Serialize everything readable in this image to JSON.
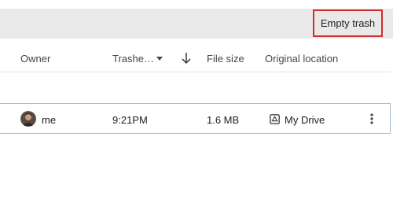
{
  "toolbar": {
    "empty_trash_label": "Empty trash"
  },
  "columns": {
    "owner": "Owner",
    "trashed": "Trashe…",
    "file_size": "File size",
    "original_location": "Original location"
  },
  "rows": [
    {
      "owner": "me",
      "trashed": "9:21PM",
      "file_size": "1.6 MB",
      "location": "My Drive"
    }
  ],
  "icons": {
    "sort": "chevron-down-icon",
    "sort_direction": "arrow-down-icon",
    "drive": "drive-icon",
    "more": "more-vert-icon"
  },
  "colors": {
    "highlight_border": "#d32d2d",
    "row_border": "#9fb9d6",
    "banner": "#e9e9e9"
  }
}
